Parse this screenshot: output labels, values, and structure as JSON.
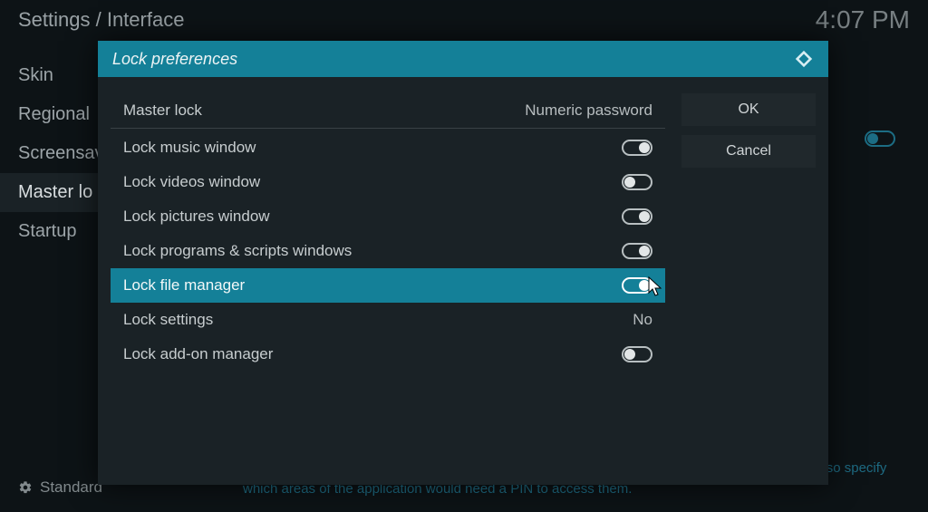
{
  "header": {
    "breadcrumb": "Settings / Interface",
    "clock": "4:07 PM"
  },
  "sidebar": {
    "items": [
      {
        "label": "Skin"
      },
      {
        "label": "Regional"
      },
      {
        "label": "Screensav"
      },
      {
        "label": "Master lo"
      },
      {
        "label": "Startup"
      }
    ],
    "selected_index": 3,
    "level_label": "Standard"
  },
  "help_text": "Here you can enable or disable master lock and define the PIN code used to unlock it. You can also specify which areas of the application would need a PIN to access them.",
  "dialog": {
    "title": "Lock preferences",
    "settings": [
      {
        "label": "Master lock",
        "value": "Numeric password"
      },
      {
        "label": "Lock music window",
        "toggle": true
      },
      {
        "label": "Lock videos window",
        "toggle": false
      },
      {
        "label": "Lock pictures window",
        "toggle": true
      },
      {
        "label": "Lock programs & scripts windows",
        "toggle": true
      },
      {
        "label": "Lock file manager",
        "toggle": true,
        "highlighted": true
      },
      {
        "label": "Lock settings",
        "value": "No"
      },
      {
        "label": "Lock add-on manager",
        "toggle": false
      }
    ],
    "actions": {
      "ok": "OK",
      "cancel": "Cancel"
    }
  }
}
